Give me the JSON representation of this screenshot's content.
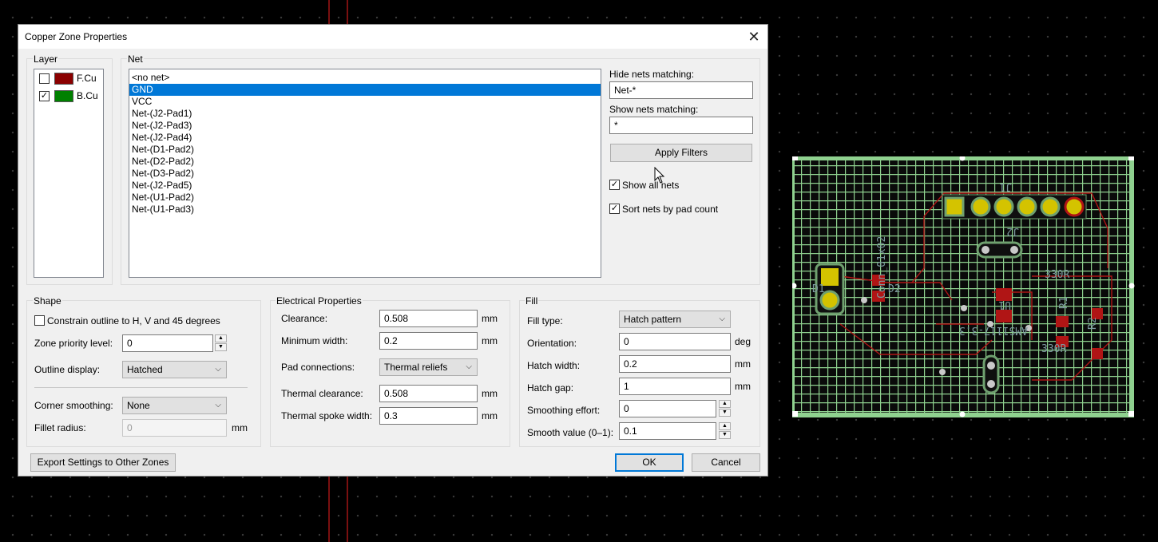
{
  "dialog": {
    "title": "Copper Zone Properties",
    "close_glyph": "✕"
  },
  "layer": {
    "label": "Layer",
    "items": [
      {
        "name": "F.Cu",
        "checked": false,
        "color": "#8b0000"
      },
      {
        "name": "B.Cu",
        "checked": true,
        "color": "#008000"
      }
    ]
  },
  "net": {
    "label": "Net",
    "items": [
      "<no net>",
      "GND",
      "VCC",
      "Net-(J2-Pad1)",
      "Net-(J2-Pad3)",
      "Net-(J2-Pad4)",
      "Net-(D1-Pad2)",
      "Net-(D2-Pad2)",
      "Net-(D3-Pad2)",
      "Net-(J2-Pad5)",
      "Net-(U1-Pad2)",
      "Net-(U1-Pad3)"
    ],
    "selected_index": 1,
    "hide_label": "Hide nets matching:",
    "hide_value": "Net-*",
    "show_label": "Show nets matching:",
    "show_value": "*",
    "apply_filters": "Apply Filters",
    "show_all_nets": "Show all nets",
    "show_all_nets_checked": true,
    "sort_by_pad": "Sort nets by pad count",
    "sort_by_pad_checked": true
  },
  "shape": {
    "label": "Shape",
    "constrain": "Constrain outline to H, V and 45 degrees",
    "constrain_checked": false,
    "priority_label": "Zone priority level:",
    "priority_value": "0",
    "outline_label": "Outline display:",
    "outline_value": "Hatched",
    "corner_label": "Corner smoothing:",
    "corner_value": "None",
    "fillet_label": "Fillet radius:",
    "fillet_value": "0",
    "fillet_unit": "mm"
  },
  "electrical": {
    "label": "Electrical Properties",
    "clearance_label": "Clearance:",
    "clearance_value": "0.508",
    "min_width_label": "Minimum width:",
    "min_width_value": "0.2",
    "pad_conn_label": "Pad connections:",
    "pad_conn_value": "Thermal reliefs",
    "thermal_clear_label": "Thermal clearance:",
    "thermal_clear_value": "0.508",
    "spoke_label": "Thermal spoke width:",
    "spoke_value": "0.3",
    "unit": "mm"
  },
  "fill": {
    "label": "Fill",
    "type_label": "Fill type:",
    "type_value": "Hatch pattern",
    "orientation_label": "Orientation:",
    "orientation_value": "0",
    "orientation_unit": "deg",
    "hatch_width_label": "Hatch width:",
    "hatch_width_value": "0.2",
    "hatch_gap_label": "Hatch gap:",
    "hatch_gap_value": "1",
    "smooth_effort_label": "Smoothing effort:",
    "smooth_effort_value": "0",
    "smooth_value_label": "Smooth value (0–1):",
    "smooth_value_value": "0.1",
    "unit": "mm"
  },
  "buttons": {
    "export": "Export Settings to Other Zones",
    "ok": "OK",
    "cancel": "Cancel"
  },
  "pcb": {
    "labels": [
      "J1",
      "J2",
      "U1",
      "330R",
      "Conn_01x02",
      "D1",
      "D2",
      "AMS1117-3.3",
      "330R",
      "R1",
      "R2"
    ]
  }
}
